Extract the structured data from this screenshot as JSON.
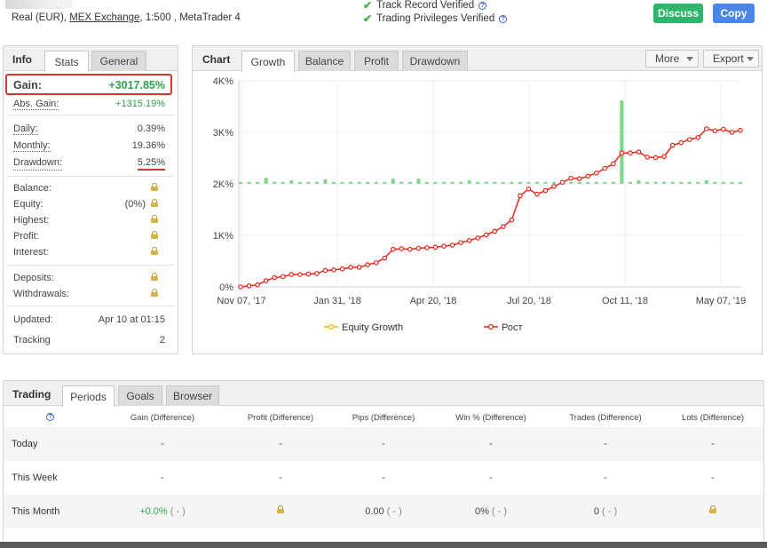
{
  "header": {
    "account_prefix": "Real (EUR),",
    "broker": "MEX Exchange",
    "account_suffix": ", 1:500 , MetaTrader 4",
    "verified": [
      {
        "label": "Track Record Verified"
      },
      {
        "label": "Trading Privileges Verified"
      }
    ],
    "discuss_label": "Discuss",
    "copy_label": "Copy"
  },
  "info": {
    "tabs": [
      "Info",
      "Stats",
      "General"
    ],
    "gain_label": "Gain:",
    "gain_value": "+3017.85%",
    "abs_gain_label": "Abs. Gain:",
    "abs_gain_value": "+1315.19%",
    "daily_label": "Daily:",
    "daily_value": "0.39%",
    "monthly_label": "Monthly:",
    "monthly_value": "19.36%",
    "drawdown_label": "Drawdown:",
    "drawdown_value": "5.25%",
    "balance_label": "Balance:",
    "equity_label": "Equity:",
    "equity_value": "(0%)",
    "highest_label": "Highest:",
    "profit_label": "Profit:",
    "interest_label": "Interest:",
    "deposits_label": "Deposits:",
    "withdrawals_label": "Withdrawals:",
    "updated_label": "Updated:",
    "updated_value": "Apr 10 at 01:15",
    "tracking_label": "Tracking",
    "tracking_value": "2"
  },
  "chart_panel": {
    "title": "Chart",
    "tabs": [
      "Growth",
      "Balance",
      "Profit",
      "Drawdown"
    ],
    "more_label": "More",
    "export_label": "Export"
  },
  "chart_data": {
    "type": "line",
    "y_tick_labels": [
      "0%",
      "1K%",
      "2K%",
      "3K%",
      "4K%"
    ],
    "ylim": [
      0,
      4000
    ],
    "x_tick_labels": [
      "Nov 07, '17",
      "Jan 31, '18",
      "Apr 20, '18",
      "Jul 20, '18",
      "Oct 11, '18",
      "May 07, '19"
    ],
    "grid": true,
    "legend_position": "bottom",
    "series": [
      {
        "name": "Equity Growth",
        "color": "#f2b705",
        "values": []
      },
      {
        "name": "Рост",
        "color": "#e8271b",
        "values": [
          0,
          20,
          40,
          120,
          180,
          200,
          240,
          240,
          250,
          260,
          320,
          330,
          350,
          380,
          380,
          430,
          470,
          560,
          730,
          740,
          730,
          750,
          760,
          770,
          790,
          810,
          860,
          900,
          950,
          1010,
          1080,
          1170,
          1300,
          1770,
          1900,
          1800,
          1870,
          1950,
          2030,
          2110,
          2100,
          2150,
          2210,
          2300,
          2390,
          2600,
          2600,
          2620,
          2520,
          2510,
          2530,
          2750,
          2800,
          2860,
          2900,
          3070,
          3030,
          3060,
          3000,
          3040
        ]
      }
    ],
    "bar_series": {
      "color": "#7bd68a",
      "values": [
        2020,
        2020,
        2020,
        2100,
        2020,
        2020,
        2050,
        2020,
        2020,
        2020,
        2070,
        2020,
        2020,
        2020,
        2020,
        2020,
        2020,
        2020,
        2080,
        2020,
        2020,
        2080,
        2020,
        2020,
        2020,
        2020,
        2020,
        2050,
        2020,
        2020,
        2020,
        2020,
        2020,
        2020,
        2020,
        2020,
        2020,
        2020,
        2020,
        2020,
        2020,
        2020,
        2020,
        2020,
        2020,
        3600,
        2020,
        2050,
        2020,
        2020,
        2020,
        2020,
        2020,
        2020,
        2020,
        2050,
        2020,
        2020,
        2020,
        2020
      ]
    }
  },
  "trading": {
    "title": "Trading",
    "tabs": [
      "Periods",
      "Goals",
      "Browser"
    ],
    "columns": [
      "Gain (Difference)",
      "Profit (Difference)",
      "Pips (Difference)",
      "Win % (Difference)",
      "Trades (Difference)",
      "Lots (Difference)"
    ],
    "rows": [
      {
        "label": "Today",
        "gain": "-",
        "profit": "-",
        "pips": "-",
        "win": "-",
        "trades": "-",
        "lots": "-"
      },
      {
        "label": "This Week",
        "gain": "-",
        "profit": "-",
        "pips": "-",
        "win": "-",
        "trades": "-",
        "lots": "-"
      },
      {
        "label": "This Month",
        "gain": "+0.0%",
        "gain_diff": "( - )",
        "pips": "0.00",
        "pips_diff": "( - )",
        "win": "0%",
        "win_diff": "( - )",
        "trades": "0",
        "trades_diff": "( - )"
      }
    ]
  }
}
